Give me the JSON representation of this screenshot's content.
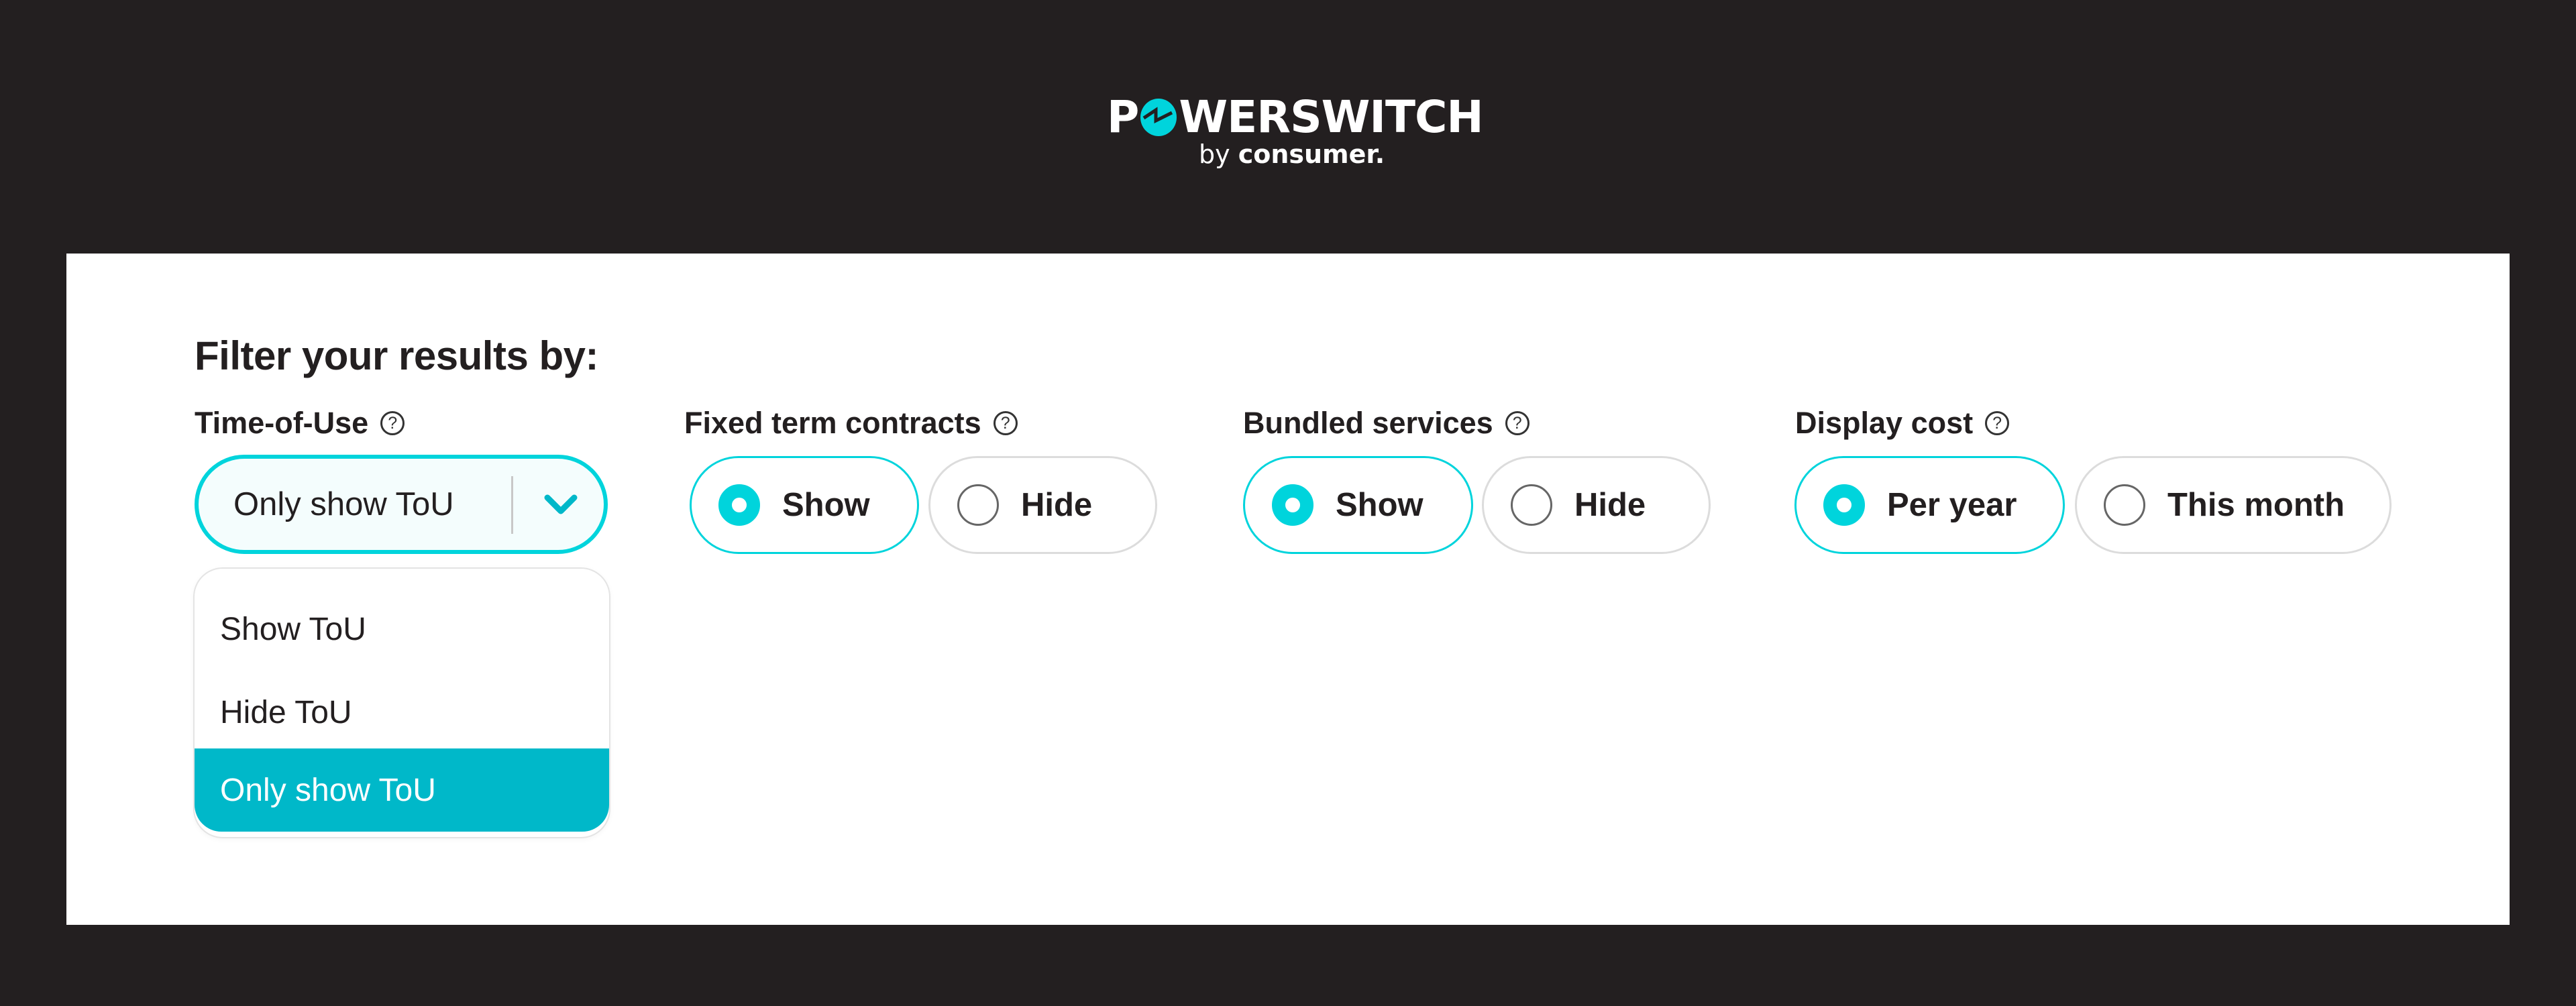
{
  "brand": {
    "name_prefix": "P",
    "name_suffix": "WERSWITCH",
    "by": "by",
    "company": "consumer.",
    "accent_color": "#00d4dc",
    "logo_icon": "power-switch-o-icon"
  },
  "filters": {
    "heading": "Filter your results by:",
    "time_of_use": {
      "label": "Time-of-Use",
      "help_icon": "?",
      "selected": "Only show ToU",
      "dropdown_open": true,
      "options": [
        {
          "label": "Show ToU",
          "highlighted": false
        },
        {
          "label": "Hide ToU",
          "highlighted": false
        },
        {
          "label": "Only show ToU",
          "highlighted": true
        }
      ]
    },
    "fixed_term_contracts": {
      "label": "Fixed term contracts",
      "help_icon": "?",
      "options": [
        {
          "label": "Show",
          "selected": true
        },
        {
          "label": "Hide",
          "selected": false
        }
      ]
    },
    "bundled_services": {
      "label": "Bundled services",
      "help_icon": "?",
      "options": [
        {
          "label": "Show",
          "selected": true
        },
        {
          "label": "Hide",
          "selected": false
        }
      ]
    },
    "display_cost": {
      "label": "Display cost",
      "help_icon": "?",
      "options": [
        {
          "label": "Per year",
          "selected": true
        },
        {
          "label": "This month",
          "selected": false
        }
      ]
    }
  },
  "colors": {
    "background": "#231f20",
    "card": "#ffffff",
    "accent": "#00d4dc",
    "highlight": "#00b8c9",
    "text": "#231f20",
    "unselected_border": "#dcdcdc"
  }
}
